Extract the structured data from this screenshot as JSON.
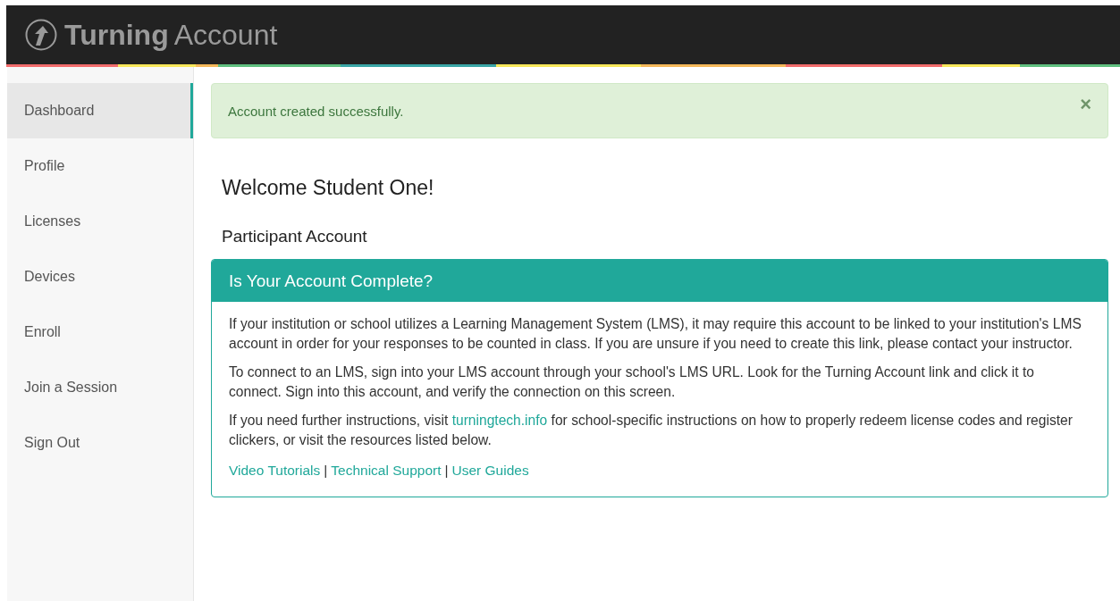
{
  "header": {
    "brand": "Turning",
    "product": "Account"
  },
  "sidebar": {
    "items": [
      {
        "label": "Dashboard",
        "selected": true
      },
      {
        "label": "Profile",
        "selected": false
      },
      {
        "label": "Licenses",
        "selected": false
      },
      {
        "label": "Devices",
        "selected": false
      },
      {
        "label": "Enroll",
        "selected": false
      },
      {
        "label": "Join a Session",
        "selected": false
      },
      {
        "label": "Sign Out",
        "selected": false
      }
    ]
  },
  "alert": {
    "message": "Account created successfully.",
    "close": "×"
  },
  "welcome": "Welcome Student One!",
  "account_type": "Participant Account",
  "panel": {
    "title": "Is Your Account Complete?",
    "paragraphs": [
      {
        "before": "If your institution or school utilizes a Learning Management System (LMS), it may require this account to be linked to your institution's LMS account in order for your responses to be counted in class. If you are unsure if you need to create this link, please contact your instructor."
      },
      {
        "before": "To connect to an LMS, sign into your LMS account through your school's LMS URL. Look for the Turning Account link and click it to connect. Sign into this account, and verify the connection on this screen."
      },
      {
        "before": "If you need further instructions, visit ",
        "link": "turningtech.info",
        "after": " for school-specific instructions on how to properly redeem license codes and register clickers, or visit the resources listed below."
      }
    ],
    "links": [
      "Video Tutorials",
      "Technical Support",
      "User Guides"
    ],
    "separator": "|"
  }
}
